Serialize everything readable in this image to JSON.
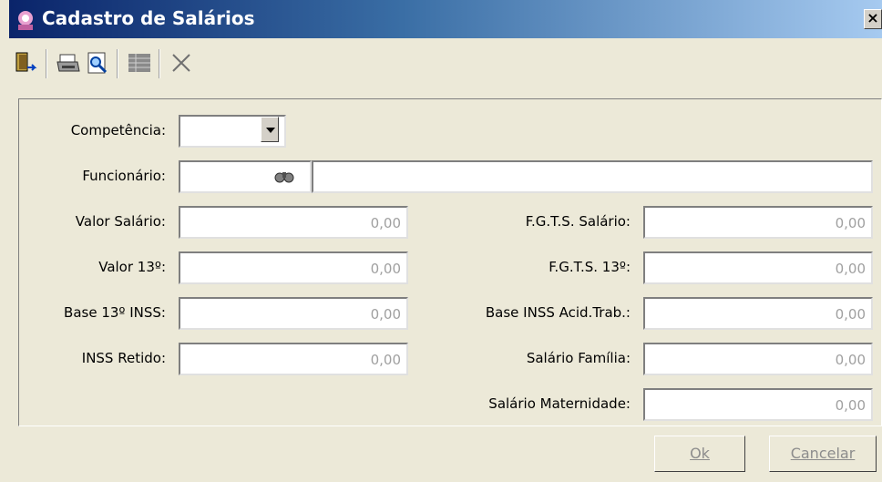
{
  "window": {
    "title": "Cadastro de Salários",
    "close_label": "×"
  },
  "toolbar": {
    "icons": [
      "exit-icon",
      "printer-icon",
      "print-preview-icon",
      "grid-icon",
      "delete-x-icon"
    ]
  },
  "form": {
    "competencia_label": "Competência:",
    "competencia_value": "",
    "funcionario_label": "Funcionário:",
    "funcionario_code": "",
    "funcionario_name": "",
    "valor_salario_label": "Valor Salário:",
    "valor_salario": "0,00",
    "valor_13_label": "Valor 13º:",
    "valor_13": "0,00",
    "base_13_inss_label": "Base 13º INSS:",
    "base_13_inss": "0,00",
    "inss_retido_label": "INSS Retido:",
    "inss_retido": "0,00",
    "fgts_salario_label": "F.G.T.S. Salário:",
    "fgts_salario": "0,00",
    "fgts_13_label": "F.G.T.S. 13º:",
    "fgts_13": "0,00",
    "base_inss_acid_label": "Base INSS Acid.Trab.:",
    "base_inss_acid": "0,00",
    "salario_familia_label": "Salário Família:",
    "salario_familia": "0,00",
    "salario_maternidade_label": "Salário Maternidade:",
    "salario_maternidade": "0,00"
  },
  "buttons": {
    "ok_label": "Ok",
    "cancel_label": "Cancelar"
  },
  "colors": {
    "title_start": "#0a246a",
    "title_end": "#a6caf0",
    "face": "#ece9d8",
    "disabled_text": "#a0a0a0"
  }
}
